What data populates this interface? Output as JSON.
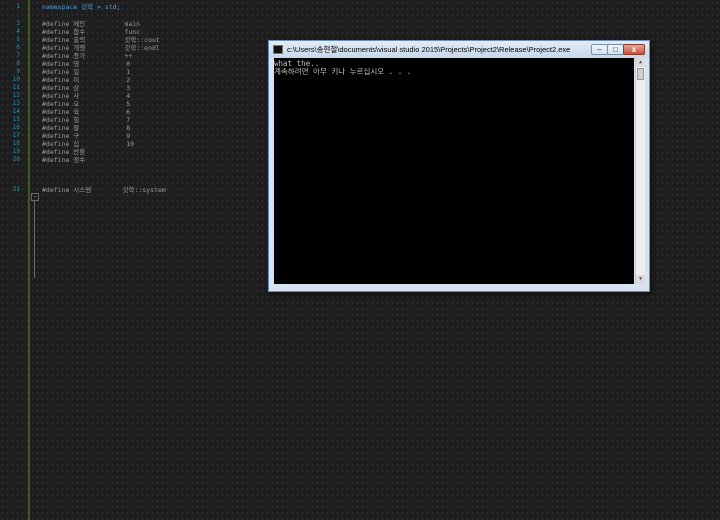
{
  "editor": {
    "lines": [
      {
        "num": "1",
        "code": "namespace 갓학 = std;",
        "type": "kw"
      },
      {
        "num": "3",
        "code": "#define 메인          main",
        "type": "pp"
      },
      {
        "num": "4",
        "code": "#define 함수          func",
        "type": "pp"
      },
      {
        "num": "5",
        "code": "#define 출력          갓학::cout",
        "type": "pp"
      },
      {
        "num": "6",
        "code": "#define 개행          갓학::endl",
        "type": "pp"
      },
      {
        "num": "7",
        "code": "#define 증가          ++",
        "type": "pp"
      },
      {
        "num": "8",
        "code": "#define 영            0",
        "type": "pp"
      },
      {
        "num": "9",
        "code": "#define 일            1",
        "type": "pp"
      },
      {
        "num": "10",
        "code": "#define 이            2",
        "type": "pp"
      },
      {
        "num": "11",
        "code": "#define 삼            3",
        "type": "pp"
      },
      {
        "num": "12",
        "code": "#define 사            4",
        "type": "pp"
      },
      {
        "num": "13",
        "code": "#define 오            5",
        "type": "pp"
      },
      {
        "num": "14",
        "code": "#define 육            6",
        "type": "pp"
      },
      {
        "num": "15",
        "code": "#define 칠            7",
        "type": "pp"
      },
      {
        "num": "16",
        "code": "#define 팔            8",
        "type": "pp"
      },
      {
        "num": "17",
        "code": "#define 구            9",
        "type": "pp"
      },
      {
        "num": "18",
        "code": "#define 십            10",
        "type": "pp"
      },
      {
        "num": "19",
        "code": "#define 반환",
        "type": "pp"
      },
      {
        "num": "20",
        "code": "#define 정수",
        "type": "pp"
      },
      {
        "num": "21",
        "code": "#define 시스템        갓학::system",
        "type": "pp"
      }
    ]
  },
  "console": {
    "title": "c:\\Users\\송현철\\documents\\visual studio 2015\\Projects\\Project2\\Release\\Project2.exe",
    "output": [
      "what the..",
      "계속하려면 아무 키나 누르십시오 . . ."
    ],
    "minimize_glyph": "–",
    "maximize_glyph": "□",
    "close_glyph": "x"
  },
  "colors": {
    "editor_bg": "#1e1e1e",
    "line_number": "#2b91af",
    "keyword": "#569cd6",
    "macro": "#bd63c5",
    "console_bg": "#000000"
  }
}
